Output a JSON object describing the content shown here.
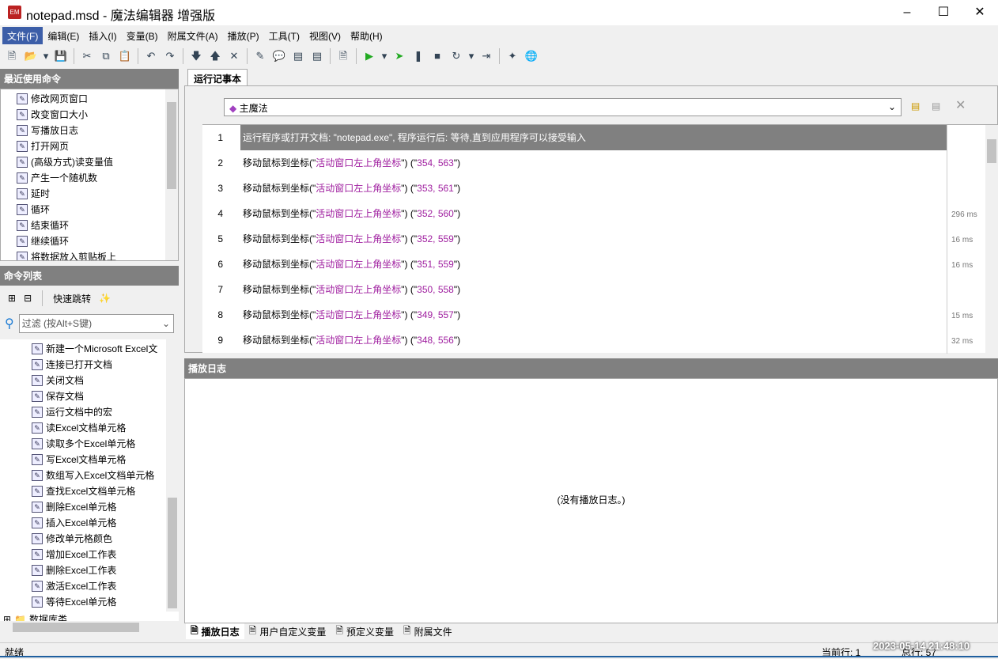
{
  "window": {
    "title": "notepad.msd - 魔法编辑器 增强版",
    "icon": "app-icon",
    "controls": [
      "minimize",
      "maximize",
      "close"
    ]
  },
  "menu": [
    "文件(F)",
    "编辑(E)",
    "插入(I)",
    "变量(B)",
    "附属文件(A)",
    "播放(P)",
    "工具(T)",
    "视图(V)",
    "帮助(H)"
  ],
  "toolbar": [
    "new-icon",
    "open-icon",
    "dropdown-icon",
    "save-icon",
    "|",
    "cut-icon",
    "copy-icon",
    "paste-icon",
    "|",
    "undo-icon",
    "redo-icon",
    "|",
    "move-down-icon",
    "move-up-icon",
    "delete-icon",
    "|",
    "edit-icon",
    "comment-icon",
    "list-icon",
    "panel-icon",
    "|",
    "script-icon",
    "|",
    "play-icon",
    "dropdown-icon",
    "step-icon",
    "pause-icon",
    "stop-icon",
    "loop-icon",
    "dropdown-icon",
    "jump-icon",
    "|",
    "cursor-icon",
    "browser-icon"
  ],
  "recent": {
    "title": "最近使用命令",
    "items": [
      "修改网页窗口",
      "改变窗口大小",
      "写播放日志",
      "打开网页",
      "(高级方式)读变量值",
      "产生一个随机数",
      "延时",
      "循环",
      "结束循环",
      "继续循环",
      "将数据放入剪贴板上"
    ]
  },
  "commands": {
    "title": "命令列表",
    "quick_jump": "快速跳转",
    "filter_placeholder": "过滤 (按Alt+S键)",
    "items": [
      "新建一个Microsoft Excel文",
      "连接已打开文档",
      "关闭文档",
      "保存文档",
      "运行文档中的宏",
      "读Excel文档单元格",
      "读取多个Excel单元格",
      "写Excel文档单元格",
      "数组写入Excel文档单元格",
      "查找Excel文档单元格",
      "删除Excel单元格",
      "插入Excel单元格",
      "修改单元格颜色",
      "增加Excel工作表",
      "删除Excel工作表",
      "激活Excel工作表",
      "等待Excel单元格"
    ],
    "folder": "数据库类"
  },
  "editor": {
    "tab": "运行记事本",
    "function_select": "主魔法",
    "rows": [
      {
        "n": "1",
        "text": "运行程序或打开文档: \"notepad.exe\", 程序运行后: 等待,直到应用程序可以接受输入",
        "ms": ""
      },
      {
        "n": "2",
        "pre": "移动鼠标到坐标(\"",
        "arg": "活动窗口左上角坐标",
        "mid": "\") (\"",
        "val": "354, 563",
        "post": "\")",
        "ms": ""
      },
      {
        "n": "3",
        "pre": "移动鼠标到坐标(\"",
        "arg": "活动窗口左上角坐标",
        "mid": "\") (\"",
        "val": "353, 561",
        "post": "\")",
        "ms": ""
      },
      {
        "n": "4",
        "pre": "移动鼠标到坐标(\"",
        "arg": "活动窗口左上角坐标",
        "mid": "\") (\"",
        "val": "352, 560",
        "post": "\")",
        "ms": "296 ms"
      },
      {
        "n": "5",
        "pre": "移动鼠标到坐标(\"",
        "arg": "活动窗口左上角坐标",
        "mid": "\") (\"",
        "val": "352, 559",
        "post": "\")",
        "ms": "16 ms"
      },
      {
        "n": "6",
        "pre": "移动鼠标到坐标(\"",
        "arg": "活动窗口左上角坐标",
        "mid": "\") (\"",
        "val": "351, 559",
        "post": "\")",
        "ms": "16 ms"
      },
      {
        "n": "7",
        "pre": "移动鼠标到坐标(\"",
        "arg": "活动窗口左上角坐标",
        "mid": "\") (\"",
        "val": "350, 558",
        "post": "\")",
        "ms": ""
      },
      {
        "n": "8",
        "pre": "移动鼠标到坐标(\"",
        "arg": "活动窗口左上角坐标",
        "mid": "\") (\"",
        "val": "349, 557",
        "post": "\")",
        "ms": "15 ms"
      },
      {
        "n": "9",
        "pre": "移动鼠标到坐标(\"",
        "arg": "活动窗口左上角坐标",
        "mid": "\") (\"",
        "val": "348, 556",
        "post": "\")",
        "ms": "32 ms"
      }
    ]
  },
  "log": {
    "title": "播放日志",
    "empty": "(没有播放日志。)"
  },
  "bottom_tabs": [
    "播放日志",
    "用户自定义变量",
    "预定义变量",
    "附属文件"
  ],
  "status": {
    "left": "就绪",
    "current_line": "当前行: 1",
    "total_lines": "总行: 57",
    "datetime": "2023-05-14  21:48:10"
  },
  "colors": {
    "header": "#808080",
    "menu_active": "#3c5ea8",
    "arg": "#a020a0"
  }
}
